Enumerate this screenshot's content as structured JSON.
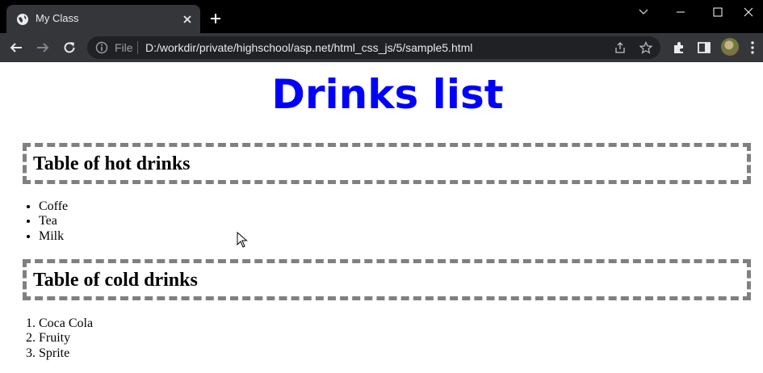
{
  "browser": {
    "tab_title": "My Class",
    "url_scheme": "File",
    "url": "D:/workdir/private/highschool/asp.net/html_css_js/5/sample5.html"
  },
  "page": {
    "title": "Drinks list",
    "hot_heading": "Table of hot drinks",
    "hot_items": [
      "Coffe",
      "Tea",
      "Milk"
    ],
    "cold_heading": "Table of cold drinks",
    "cold_items": [
      "Coca Cola",
      "Fruity",
      "Sprite"
    ]
  },
  "colors": {
    "title": "#0000ff",
    "box_border": "#808080",
    "tab_active": "#35363a",
    "tabbar": "#000000"
  }
}
